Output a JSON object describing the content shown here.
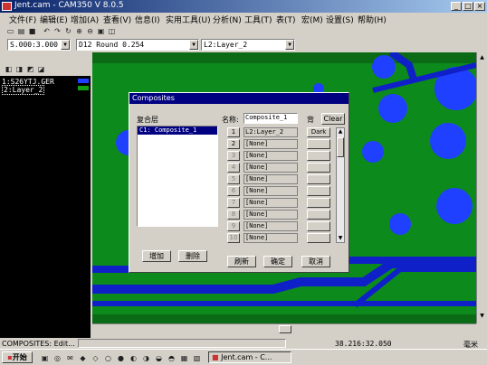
{
  "window": {
    "title": "Jent.cam - CAM350 V 8.0.5",
    "minimize": "_",
    "maximize": "□",
    "close": "×"
  },
  "menu": [
    "文件(F)",
    "编辑(E)",
    "增加(A)",
    "查看(V)",
    "信息(I)",
    "实用工具(U)",
    "分析(N)",
    "工具(T)",
    "表(T)",
    "宏(M)",
    "设置(S)",
    "帮助(H)"
  ],
  "toolbar": {
    "coords": "S.000:3.000",
    "dcode": "D12   Round 0.254",
    "layer": "L2:Layer_2"
  },
  "layers": [
    {
      "label": "1:S26YTJ.GER",
      "color": "#2040ff"
    },
    {
      "label": "2:Layer_2",
      "color": "#10a010"
    }
  ],
  "dialog": {
    "title": "Composites",
    "composite_label": "复合层",
    "composite_items": [
      "C1: Composite_1"
    ],
    "name_label": "名称:",
    "name_value": "Composite_1",
    "back_label": "背",
    "clear_button": "Clear",
    "rows": [
      {
        "num": "1",
        "layer": "L2:Layer_2",
        "polarity": "Dark"
      },
      {
        "num": "2",
        "layer": "[None]",
        "polarity": ""
      },
      {
        "num": "3",
        "layer": "[None]",
        "polarity": ""
      },
      {
        "num": "4",
        "layer": "[None]",
        "polarity": ""
      },
      {
        "num": "5",
        "layer": "[None]",
        "polarity": ""
      },
      {
        "num": "6",
        "layer": "[None]",
        "polarity": ""
      },
      {
        "num": "7",
        "layer": "[None]",
        "polarity": ""
      },
      {
        "num": "8",
        "layer": "[None]",
        "polarity": ""
      },
      {
        "num": "9",
        "layer": "[None]",
        "polarity": ""
      },
      {
        "num": "10",
        "layer": "[None]",
        "polarity": ""
      }
    ],
    "add_button": "增加",
    "delete_button": "删除",
    "refresh_button": "刷新",
    "ok_button": "确定",
    "cancel_button": "取消"
  },
  "status": {
    "left": "COMPOSITES: Edit...",
    "coords": "38.216:32.050",
    "unit": "毫米"
  },
  "taskbar": {
    "start": "开始",
    "task": "Jent.cam - C..."
  },
  "colors": {
    "board_green": "#0c8a1c",
    "copper_blue": "#1020c8",
    "pad_blue": "#2040ff",
    "titlebar": "#0a246a"
  }
}
